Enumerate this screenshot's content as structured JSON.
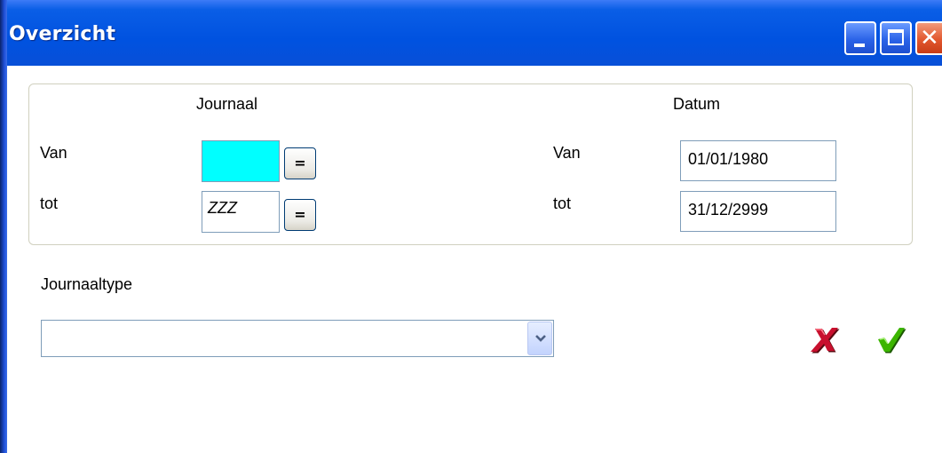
{
  "window": {
    "title": "Overzicht",
    "controls": [
      "minimize-icon",
      "maximize-icon",
      "close-icon"
    ]
  },
  "range_group": {
    "journaal_header": "Journaal",
    "datum_header": "Datum",
    "journaal": {
      "van_label": "Van",
      "tot_label": "tot",
      "van_value": "",
      "tot_value": "ZZZ",
      "lookup_button_label": "="
    },
    "datum": {
      "van_label": "Van",
      "tot_label": "tot",
      "van_value": "01/01/1980",
      "tot_value": "31/12/2999"
    }
  },
  "journaaltype": {
    "label": "Journaaltype",
    "selected_value": ""
  },
  "actions": {
    "cancel_icon": "red-x-icon",
    "confirm_icon": "green-check-icon"
  },
  "colors": {
    "title_bar": "#0052e0",
    "highlight_field": "#00ffff",
    "cancel": "#c8102e",
    "confirm": "#3cb500"
  }
}
